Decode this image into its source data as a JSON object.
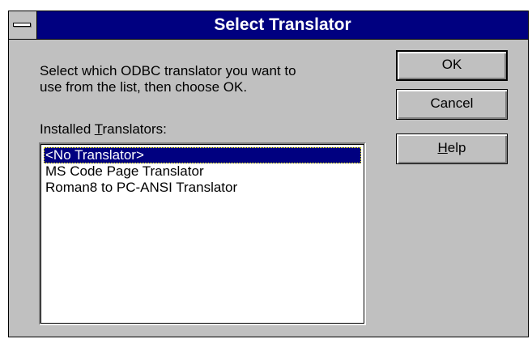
{
  "window": {
    "title": "Select Translator"
  },
  "prompt": {
    "line1": "Select which ODBC translator you want to",
    "line2": "use from the list, then choose OK."
  },
  "list_label": {
    "before": "Installed ",
    "mnemonic": "T",
    "after": "ranslators:"
  },
  "translators": [
    {
      "label": "<No Translator>",
      "selected": true
    },
    {
      "label": "MS Code Page Translator",
      "selected": false
    },
    {
      "label": "Roman8 to PC-ANSI Translator",
      "selected": false
    }
  ],
  "buttons": {
    "ok": "OK",
    "cancel": "Cancel",
    "help_mnemonic": "H",
    "help_rest": "elp"
  },
  "colors": {
    "title_bar": "#000080",
    "face": "#c0c0c0",
    "selection": "#000080"
  }
}
